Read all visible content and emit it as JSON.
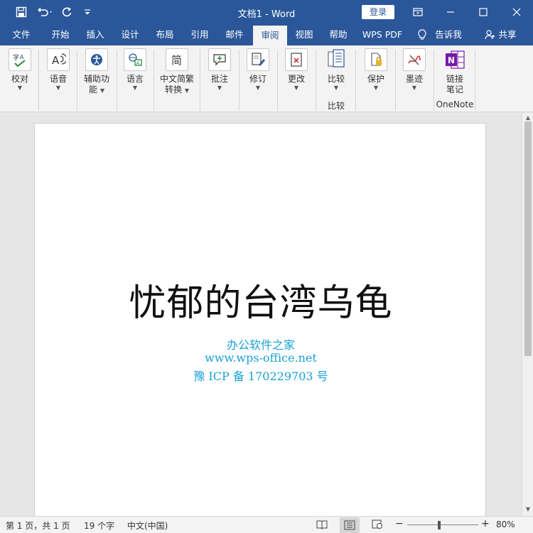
{
  "titlebar": {
    "title": "文档1  -  Word",
    "login": "登录"
  },
  "tabs": [
    {
      "label": "文件"
    },
    {
      "label": "开始"
    },
    {
      "label": "插入"
    },
    {
      "label": "设计"
    },
    {
      "label": "布局"
    },
    {
      "label": "引用"
    },
    {
      "label": "邮件"
    },
    {
      "label": "审阅"
    },
    {
      "label": "视图"
    },
    {
      "label": "帮助"
    },
    {
      "label": "WPS PDF"
    },
    {
      "label": "告诉我"
    },
    {
      "label": "共享"
    }
  ],
  "ribbon": {
    "proofing": "校对",
    "speech": "语音",
    "accessibility_1": "辅助功",
    "accessibility_2": "能",
    "language": "语言",
    "chinese_conv_1": "中文简繁",
    "chinese_conv_2": "转换",
    "comments": "批注",
    "tracking": "修订",
    "changes": "更改",
    "compare": "比较",
    "compare_group": "比较",
    "protect": "保护",
    "ink": "墨迹",
    "onenote_1": "链接",
    "onenote_2": "笔记",
    "onenote_group": "OneNote"
  },
  "document": {
    "heading": "忧郁的台湾乌龟",
    "line1": "办公软件之家",
    "line2": "www.wps-office.net",
    "line3": "豫 ICP 备 170229703 号"
  },
  "status": {
    "page": "第 1 页，共 1 页",
    "words": "19 个字",
    "language": "中文(中国)",
    "zoom": "80%",
    "zoom_level": 0.8
  },
  "colors": {
    "brand": "#2b579a",
    "link": "#1aa1d6"
  }
}
